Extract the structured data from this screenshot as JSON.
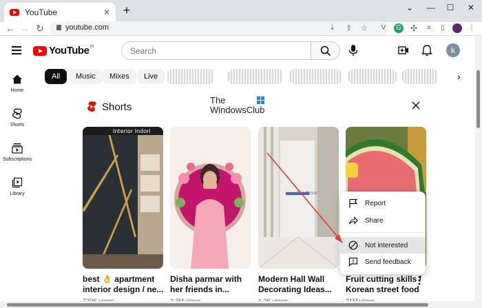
{
  "browser": {
    "tab_title": "YouTube",
    "tab_close": "✕",
    "new_tab": "+",
    "url": "youtube.com",
    "window_controls": [
      "⌄",
      "—",
      "☐",
      "✕"
    ]
  },
  "header": {
    "logo_text": "YouTube",
    "country_code": "IN",
    "search_placeholder": "Search",
    "avatar_letter": "k"
  },
  "sidebar": {
    "items": [
      {
        "label": "Home",
        "icon": "home-icon"
      },
      {
        "label": "Shorts",
        "icon": "shorts-icon"
      },
      {
        "label": "Subscriptions",
        "icon": "subscriptions-icon"
      },
      {
        "label": "Library",
        "icon": "library-icon"
      }
    ]
  },
  "chips": [
    "All",
    "Music",
    "Mixes",
    "Live"
  ],
  "shorts": {
    "title": "Shorts",
    "watermark_line1": "The",
    "watermark_line2": "WindowsClub",
    "items": [
      {
        "title_line1": "best 👌 apartment",
        "title_line2": "interior design / ne...",
        "views": "720K views",
        "overlay": "Interior Indori"
      },
      {
        "title_line1": "Disha parmar with",
        "title_line2": "her friends in...",
        "views": "2.3M views"
      },
      {
        "title_line1": "Modern Hall Wall",
        "title_line2": "Decorating Ideas...",
        "views": "1.3K views",
        "overlay": "Luxe Tile Mirror"
      },
      {
        "title_line1": "Fruit cutting skills /",
        "title_line2": "Korean street food",
        "views": "21M views"
      }
    ]
  },
  "context_menu": {
    "report": "Report",
    "share": "Share",
    "not_interested": "Not interested",
    "send_feedback": "Send feedback"
  },
  "colors": {
    "brand_red": "#ff0000",
    "arrow_red": "#e53935"
  }
}
